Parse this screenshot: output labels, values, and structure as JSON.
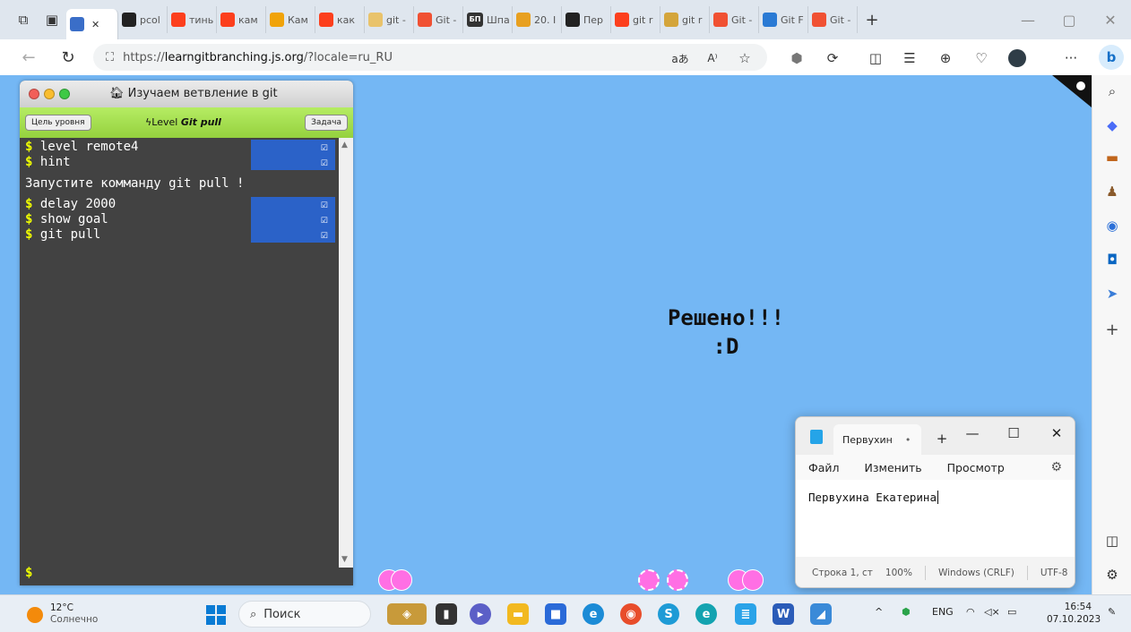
{
  "browser": {
    "tabs": [
      {
        "label": "",
        "favicon": "learngit-favicon",
        "color": "#3a6ec8"
      },
      {
        "label": "pcol",
        "favicon": "github-icon",
        "color": "#222222"
      },
      {
        "label": "тинь",
        "favicon": "yandex-icon",
        "color": "#fc3f1d"
      },
      {
        "label": "кам",
        "favicon": "yandex-icon",
        "color": "#fc3f1d"
      },
      {
        "label": "Кам",
        "favicon": "grid-icon",
        "color": "#f0a30a"
      },
      {
        "label": "как",
        "favicon": "yandex-icon",
        "color": "#fc3f1d"
      },
      {
        "label": "git -",
        "favicon": "doc-icon",
        "color": "#e9c36b"
      },
      {
        "label": "Git -",
        "favicon": "git-icon",
        "color": "#f05133"
      },
      {
        "label": "Шпа",
        "favicon": "bp-icon",
        "color": "#333333"
      },
      {
        "label": "20. I",
        "favicon": "emoji-icon",
        "color": "#e8a020"
      },
      {
        "label": "Пер",
        "favicon": "github-icon",
        "color": "#222222"
      },
      {
        "label": "git r",
        "favicon": "yandex-icon",
        "color": "#fc3f1d"
      },
      {
        "label": "git r",
        "favicon": "image-icon",
        "color": "#d4a53b"
      },
      {
        "label": "Git -",
        "favicon": "git-icon",
        "color": "#f05133"
      },
      {
        "label": "Git F",
        "favicon": "square-icon",
        "color": "#2a7ad4"
      },
      {
        "label": "Git -",
        "favicon": "git-icon",
        "color": "#f05133"
      }
    ],
    "bp_label": "БП",
    "url_prefix": "https://",
    "url_host": "learngitbranching.js.org",
    "url_path": "/?locale=ru_RU",
    "new_tab": "+"
  },
  "terminal": {
    "title": "Изучаем ветвление в git",
    "goal_button": "Цель уровня",
    "level_prefix": "Level",
    "level_name": "Git pull",
    "task_button": "Задача",
    "commands_top": [
      {
        "text": "level remote4"
      },
      {
        "text": "hint"
      }
    ],
    "message": "Запустите комманду git pull !",
    "commands_bottom": [
      {
        "text": "delay 2000"
      },
      {
        "text": "show goal"
      },
      {
        "text": "git pull"
      }
    ],
    "prompt": "$",
    "dollar": "$",
    "check": "☑"
  },
  "canvas": {
    "solved_line1": "Решено!!!",
    "solved_line2": ":D"
  },
  "notepad": {
    "tab_title": "Первухин",
    "menu_file": "Файл",
    "menu_edit": "Изменить",
    "menu_view": "Просмотр",
    "text": "Первухина Екатерина",
    "status_pos": "Строка 1, ст",
    "status_zoom": "100%",
    "status_eol": "Windows (CRLF)",
    "status_enc": "UTF-8"
  },
  "taskbar": {
    "temperature": "12°C",
    "weather": "Солнечно",
    "search_placeholder": "Поиск",
    "lang": "ENG",
    "time": "16:54",
    "date": "07.10.2023"
  }
}
